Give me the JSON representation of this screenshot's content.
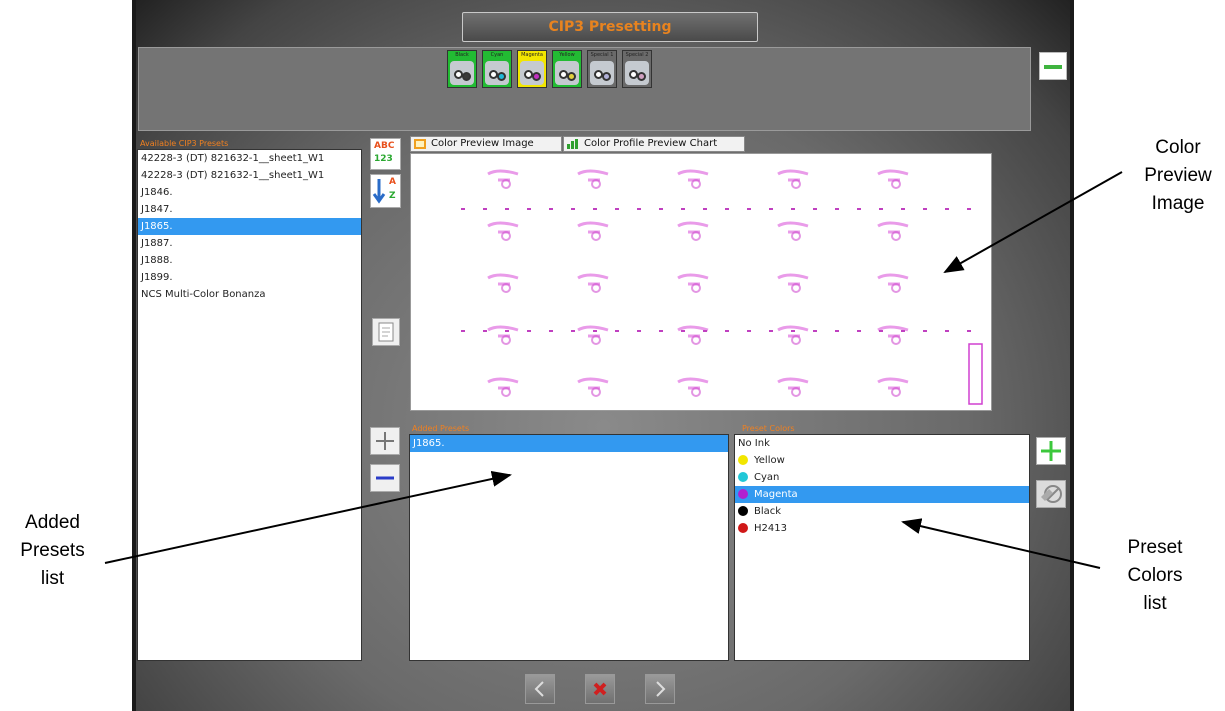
{
  "window": {
    "title": "CIP3 Presetting"
  },
  "toolbar": {
    "swatches": [
      {
        "label": "Black",
        "color": "#3a3a3a",
        "tab": "#22bb33"
      },
      {
        "label": "Cyan",
        "color": "#21b8d8",
        "tab": "#22bb33"
      },
      {
        "label": "Magenta",
        "color": "#c030c0",
        "tab": "#f2e600"
      },
      {
        "label": "Yellow",
        "color": "#e0d040",
        "tab": "#22bb33"
      },
      {
        "label": "Special 1",
        "color": "#b0b0d8",
        "tab": "#6a6a6a"
      },
      {
        "label": "Special 2",
        "color": "#d0a0c0",
        "tab": "#6a6a6a"
      }
    ],
    "collapse_button": "minus-icon"
  },
  "available_presets": {
    "label": "Available CIP3 Presets",
    "items": [
      "42228-3 (DT) 821632-1__sheet1_W1",
      "42228-3 (DT) 821632-1__sheet1_W1",
      "J1846.",
      "J1847.",
      "J1865.",
      "J1887.",
      "J1888.",
      "J1899.",
      "NCS Multi-Color Bonanza"
    ],
    "selected_index": 4
  },
  "sort_buttons": {
    "abc": "ABC",
    "num": "123",
    "az_a": "A",
    "az_z": "Z"
  },
  "tabs": [
    {
      "label": "Color Preview Image",
      "icon": "image-icon"
    },
    {
      "label": "Color Profile Preview Chart",
      "icon": "bar-chart-icon"
    }
  ],
  "added_presets": {
    "label": "Added Presets",
    "items": [
      "J1865."
    ],
    "selected_index": 0
  },
  "preset_colors": {
    "label": "Preset Colors",
    "items": [
      {
        "name": "No Ink",
        "color": ""
      },
      {
        "name": "Yellow",
        "color": "#f2e600"
      },
      {
        "name": "Cyan",
        "color": "#21c8d8"
      },
      {
        "name": "Magenta",
        "color": "#b020d0"
      },
      {
        "name": "Black",
        "color": "#000000"
      },
      {
        "name": "H2413",
        "color": "#d01818"
      }
    ],
    "selected_index": 3
  },
  "nav": {
    "prev": "chevron-left-icon",
    "cancel": "close-icon",
    "next": "chevron-right-icon"
  },
  "callouts": {
    "color_preview": [
      "Color",
      "Preview",
      "Image"
    ],
    "added_presets": [
      "Added",
      "Presets",
      "list"
    ],
    "preset_colors": [
      "Preset",
      "Colors",
      "list"
    ]
  }
}
